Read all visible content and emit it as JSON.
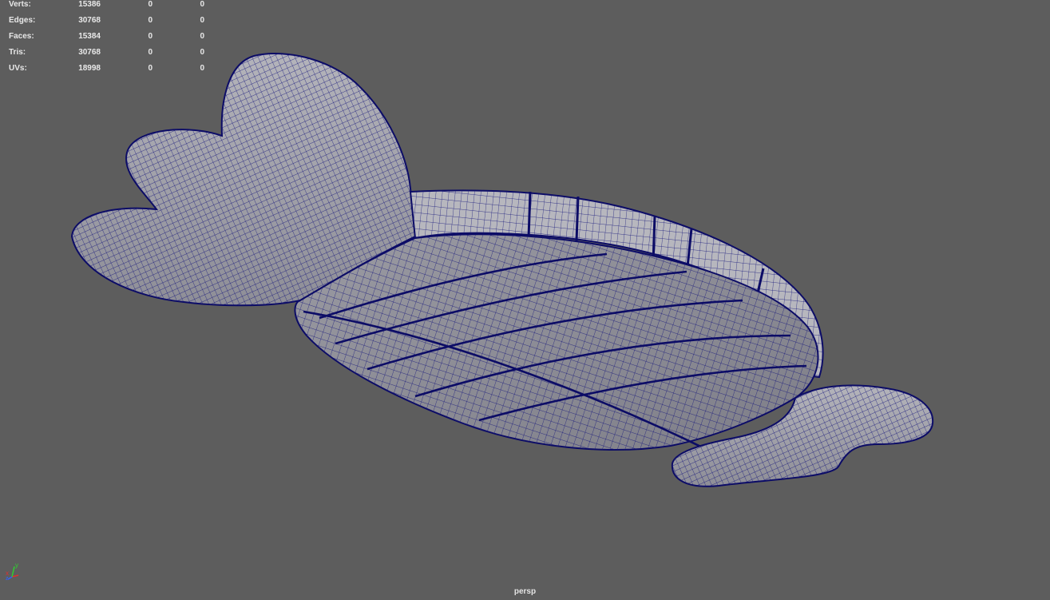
{
  "heads_up": {
    "rows": [
      {
        "label": "Verts:",
        "total": "15386",
        "selected": "0",
        "component": "0"
      },
      {
        "label": "Edges:",
        "total": "30768",
        "selected": "0",
        "component": "0"
      },
      {
        "label": "Faces:",
        "total": "15384",
        "selected": "0",
        "component": "0"
      },
      {
        "label": "Tris:",
        "total": "30768",
        "selected": "0",
        "component": "0"
      },
      {
        "label": "UVs:",
        "total": "18998",
        "selected": "0",
        "component": "0"
      }
    ]
  },
  "viewport": {
    "camera_name": "persp",
    "background_color": "#5d5d5d",
    "mesh_fill_color": "#a9a9b0",
    "wire_color": "#101070"
  },
  "axis_gizmo": {
    "x_label": "x",
    "y_label": "y",
    "z_label": "z",
    "x_color": "#e03030",
    "y_color": "#30d030",
    "z_color": "#3060ff"
  }
}
